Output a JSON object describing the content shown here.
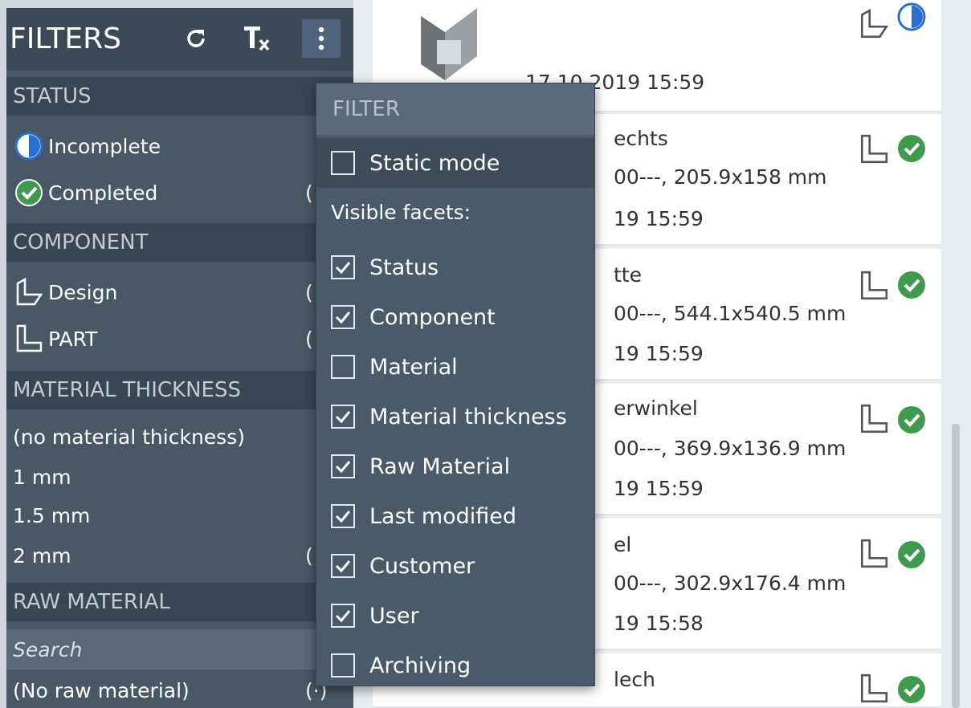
{
  "filters_panel": {
    "title": "FILTERS",
    "status_section": {
      "title": "STATUS",
      "items": [
        {
          "label": "Incomplete",
          "count": ""
        },
        {
          "label": "Completed",
          "count": "("
        }
      ]
    },
    "component_section": {
      "title": "COMPONENT",
      "items": [
        {
          "label": "Design",
          "count": "("
        },
        {
          "label": "PART",
          "count": "("
        }
      ]
    },
    "thickness_section": {
      "title": "MATERIAL THICKNESS",
      "items": [
        {
          "label": "(no material thickness)",
          "count": ""
        },
        {
          "label": "1 mm",
          "count": ""
        },
        {
          "label": "1.5 mm",
          "count": ""
        },
        {
          "label": "2 mm",
          "count": "("
        }
      ]
    },
    "raw_material_section": {
      "title": "RAW MATERIAL",
      "search_placeholder": "Search",
      "items": [
        {
          "label": "(No raw material)",
          "count": "(·)"
        }
      ]
    }
  },
  "filter_popup": {
    "title": "FILTER",
    "static_mode": {
      "label": "Static mode",
      "checked": false
    },
    "visible_facets_label": "Visible facets:",
    "facets": [
      {
        "label": "Status",
        "checked": true
      },
      {
        "label": "Component",
        "checked": true
      },
      {
        "label": "Material",
        "checked": false
      },
      {
        "label": "Material thickness",
        "checked": true
      },
      {
        "label": "Raw Material",
        "checked": true
      },
      {
        "label": "Last modified",
        "checked": true
      },
      {
        "label": "Customer",
        "checked": true
      },
      {
        "label": "User",
        "checked": true
      },
      {
        "label": "Archiving",
        "checked": false
      }
    ]
  },
  "list": {
    "cards": [
      {
        "line1": "",
        "line2": "",
        "line3": "17.10.2019 15:59",
        "type_icon": "design-icon",
        "status": "incomplete"
      },
      {
        "line1": "echts",
        "line2": "00---, 205.9x158 mm",
        "line3": "19 15:59",
        "type_icon": "part-icon",
        "status": "completed"
      },
      {
        "line1": "tte",
        "line2": "00---, 544.1x540.5 mm",
        "line3": "19 15:59",
        "type_icon": "part-icon",
        "status": "completed"
      },
      {
        "line1": "erwinkel",
        "line2": "00---, 369.9x136.9 mm",
        "line3": "19 15:59",
        "type_icon": "part-icon",
        "status": "completed"
      },
      {
        "line1": "el",
        "line2": "00---, 302.9x176.4 mm",
        "line3": "19 15:58",
        "type_icon": "part-icon",
        "status": "completed"
      },
      {
        "line1": "lech",
        "line2": "",
        "line3": "",
        "type_icon": "part-icon",
        "status": "completed"
      }
    ]
  },
  "colors": {
    "panel_bg": "#4a5866",
    "section_bg": "#3a4654",
    "popup_bg": "#4b5a69",
    "completed_green": "#3f9a4d",
    "incomplete_blue": "#2a6fcf"
  }
}
